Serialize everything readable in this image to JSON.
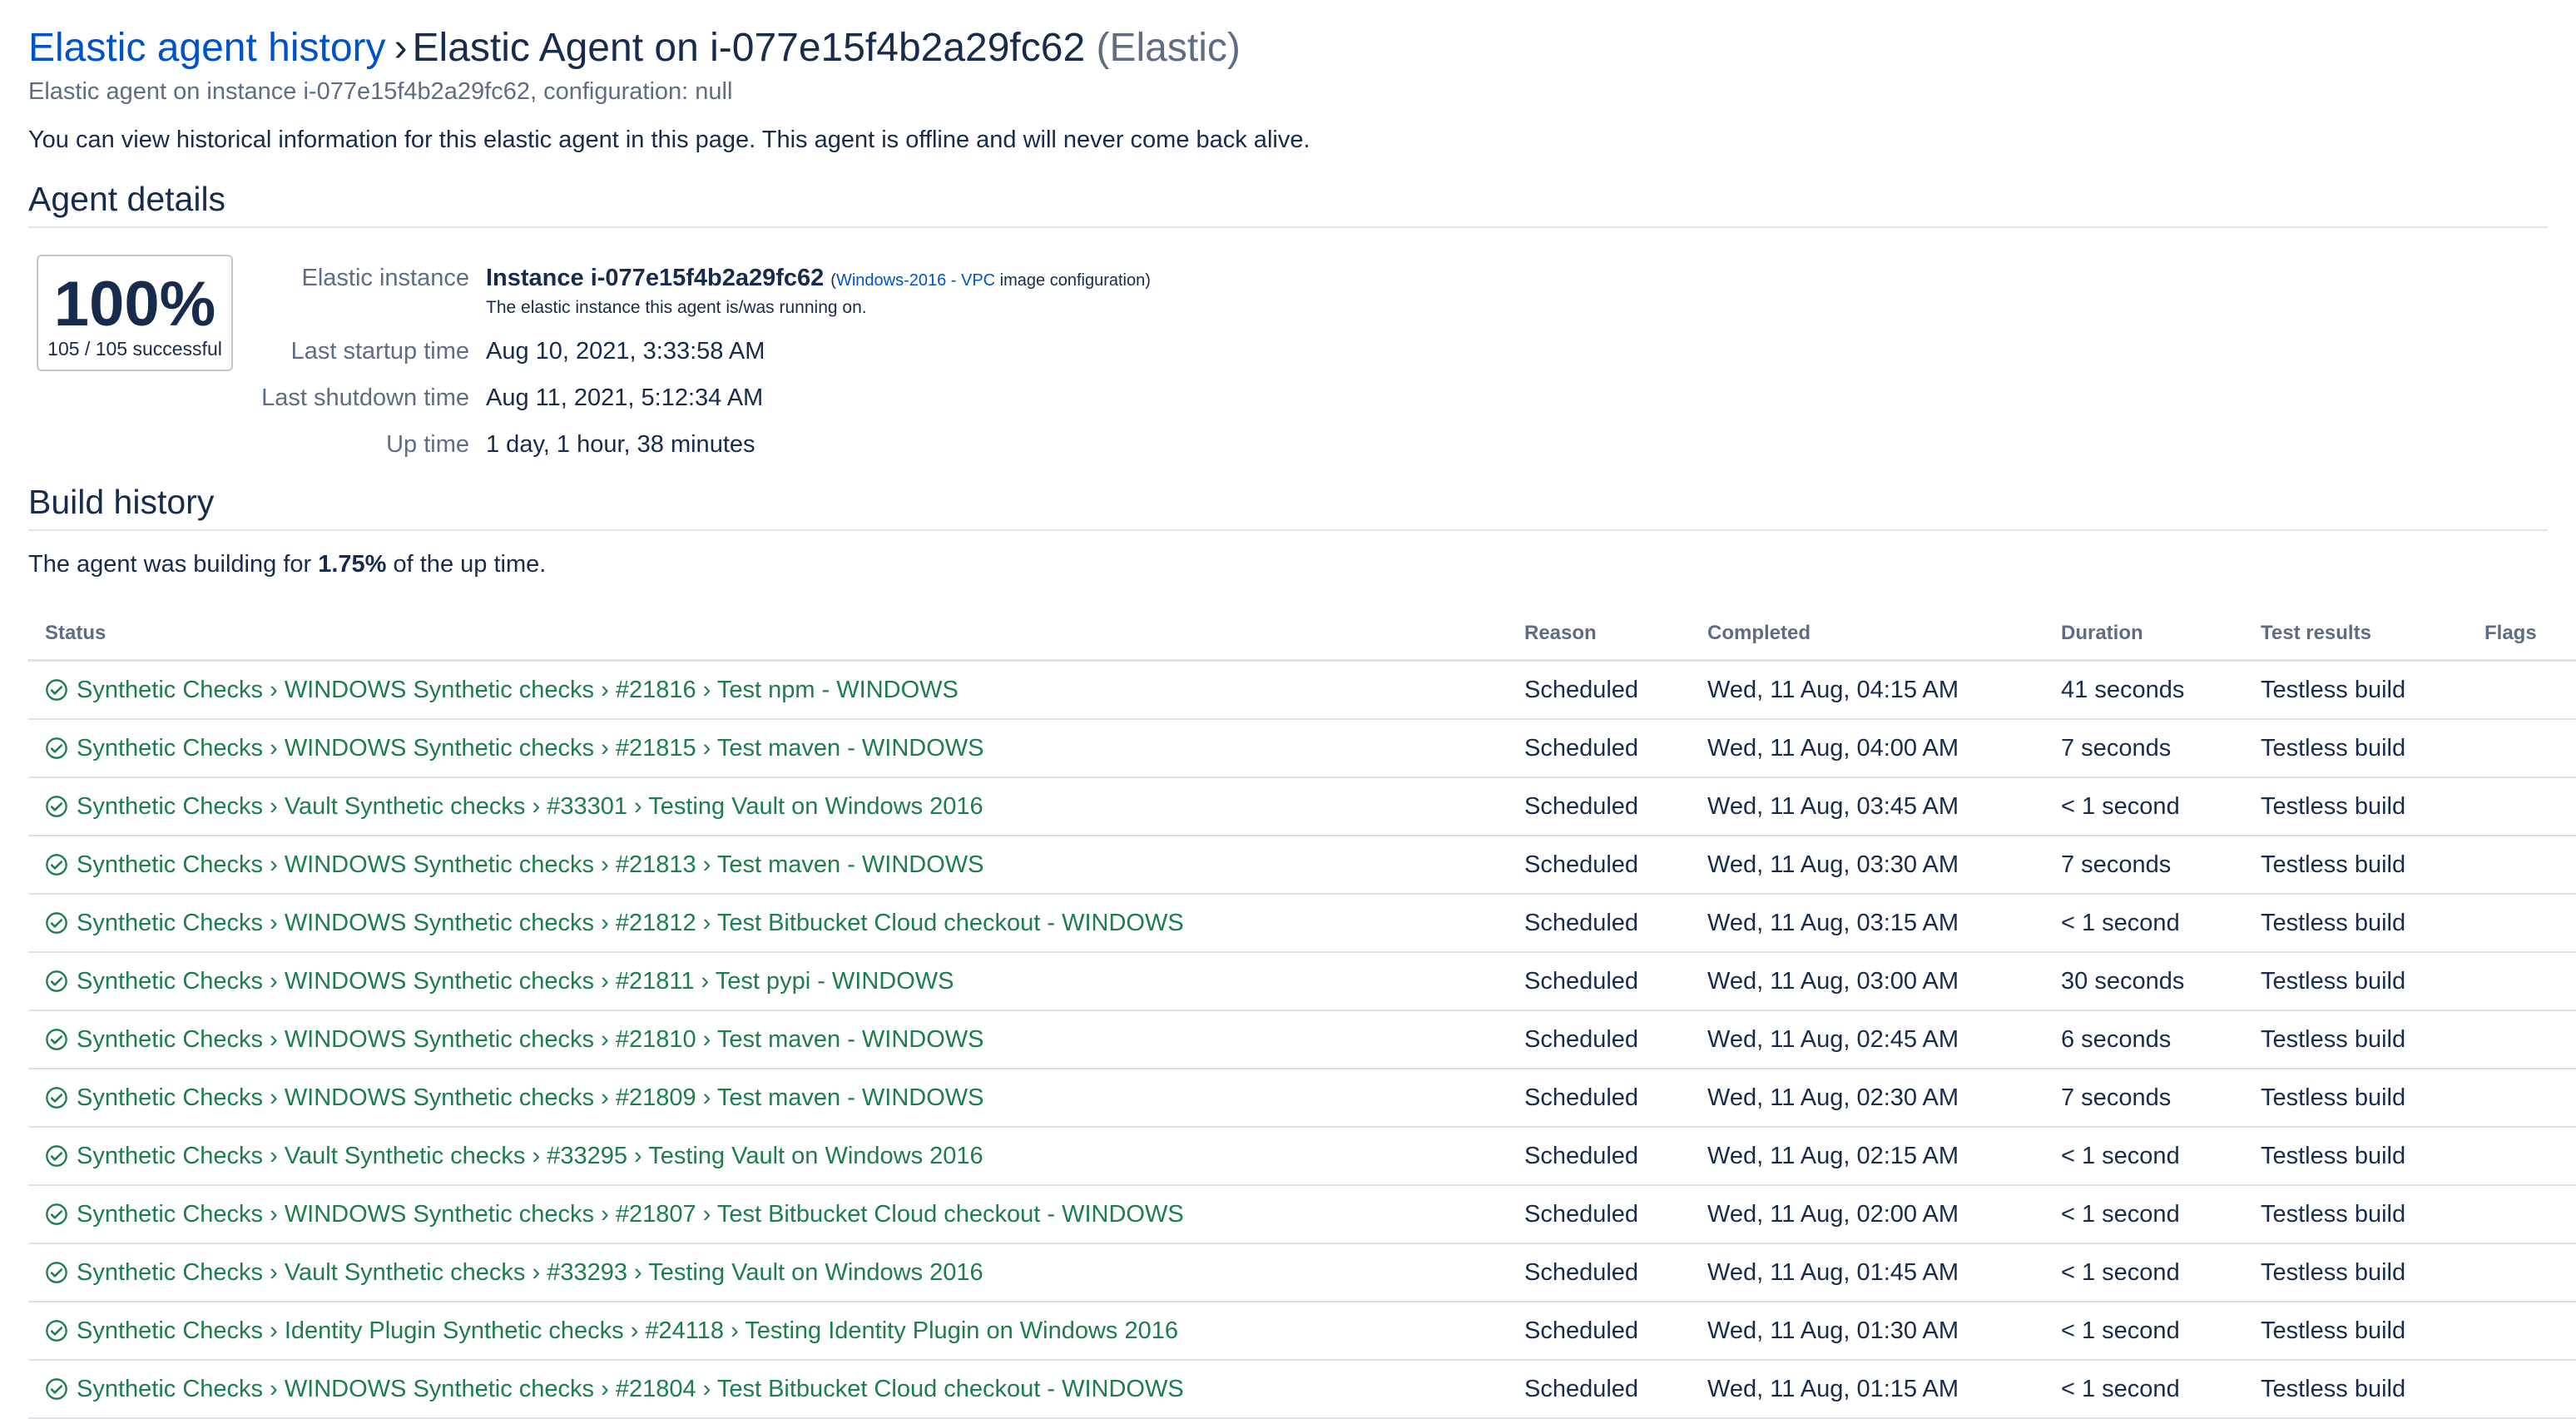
{
  "header": {
    "breadcrumb_link": "Elastic agent history",
    "separator": "›",
    "agent_title": "Elastic Agent on i-077e15f4b2a29fc62",
    "agent_type": "(Elastic)",
    "subtitle": "Elastic agent on instance i-077e15f4b2a29fc62, configuration: null",
    "intro": "You can view historical information for this elastic agent in this page. This agent is offline and will never come back alive."
  },
  "agent_details": {
    "heading": "Agent details",
    "success_percent": "100%",
    "success_count": "105 / 105 successful",
    "elastic_instance_label": "Elastic instance",
    "instance_name": "Instance i-077e15f4b2a29fc62",
    "instance_meta_open": "(",
    "instance_meta_link": "Windows-2016 - VPC",
    "instance_meta_rest": " image configuration)",
    "instance_note": "The elastic instance this agent is/was running on.",
    "last_startup_label": "Last startup time",
    "last_startup_value": "Aug 10, 2021, 3:33:58 AM",
    "last_shutdown_label": "Last shutdown time",
    "last_shutdown_value": "Aug 11, 2021, 5:12:34 AM",
    "up_time_label": "Up time",
    "up_time_value": "1 day, 1 hour, 38 minutes"
  },
  "build_history": {
    "heading": "Build history",
    "building_prefix": "The agent was building for ",
    "building_percent": "1.75%",
    "building_suffix": " of the up time.",
    "columns": [
      "Status",
      "Reason",
      "Completed",
      "Duration",
      "Test results",
      "Flags"
    ],
    "status_color": "#1c7d4d",
    "rows": [
      {
        "status": "Synthetic Checks › WINDOWS Synthetic checks › #21816 › Test npm - WINDOWS",
        "reason": "Scheduled",
        "completed": "Wed, 11 Aug, 04:15 AM",
        "duration": "41 seconds",
        "tests": "Testless build",
        "flags": ""
      },
      {
        "status": "Synthetic Checks › WINDOWS Synthetic checks › #21815 › Test maven - WINDOWS",
        "reason": "Scheduled",
        "completed": "Wed, 11 Aug, 04:00 AM",
        "duration": "7 seconds",
        "tests": "Testless build",
        "flags": ""
      },
      {
        "status": "Synthetic Checks › Vault Synthetic checks › #33301 › Testing Vault on Windows 2016",
        "reason": "Scheduled",
        "completed": "Wed, 11 Aug, 03:45 AM",
        "duration": "< 1 second",
        "tests": "Testless build",
        "flags": ""
      },
      {
        "status": "Synthetic Checks › WINDOWS Synthetic checks › #21813 › Test maven - WINDOWS",
        "reason": "Scheduled",
        "completed": "Wed, 11 Aug, 03:30 AM",
        "duration": "7 seconds",
        "tests": "Testless build",
        "flags": ""
      },
      {
        "status": "Synthetic Checks › WINDOWS Synthetic checks › #21812 › Test Bitbucket Cloud checkout - WINDOWS",
        "reason": "Scheduled",
        "completed": "Wed, 11 Aug, 03:15 AM",
        "duration": "< 1 second",
        "tests": "Testless build",
        "flags": ""
      },
      {
        "status": "Synthetic Checks › WINDOWS Synthetic checks › #21811 › Test pypi - WINDOWS",
        "reason": "Scheduled",
        "completed": "Wed, 11 Aug, 03:00 AM",
        "duration": "30 seconds",
        "tests": "Testless build",
        "flags": ""
      },
      {
        "status": "Synthetic Checks › WINDOWS Synthetic checks › #21810 › Test maven - WINDOWS",
        "reason": "Scheduled",
        "completed": "Wed, 11 Aug, 02:45 AM",
        "duration": "6 seconds",
        "tests": "Testless build",
        "flags": ""
      },
      {
        "status": "Synthetic Checks › WINDOWS Synthetic checks › #21809 › Test maven - WINDOWS",
        "reason": "Scheduled",
        "completed": "Wed, 11 Aug, 02:30 AM",
        "duration": "7 seconds",
        "tests": "Testless build",
        "flags": ""
      },
      {
        "status": "Synthetic Checks › Vault Synthetic checks › #33295 › Testing Vault on Windows 2016",
        "reason": "Scheduled",
        "completed": "Wed, 11 Aug, 02:15 AM",
        "duration": "< 1 second",
        "tests": "Testless build",
        "flags": ""
      },
      {
        "status": "Synthetic Checks › WINDOWS Synthetic checks › #21807 › Test Bitbucket Cloud checkout - WINDOWS",
        "reason": "Scheduled",
        "completed": "Wed, 11 Aug, 02:00 AM",
        "duration": "< 1 second",
        "tests": "Testless build",
        "flags": ""
      },
      {
        "status": "Synthetic Checks › Vault Synthetic checks › #33293 › Testing Vault on Windows 2016",
        "reason": "Scheduled",
        "completed": "Wed, 11 Aug, 01:45 AM",
        "duration": "< 1 second",
        "tests": "Testless build",
        "flags": ""
      },
      {
        "status": "Synthetic Checks › Identity Plugin Synthetic checks › #24118 › Testing Identity Plugin on Windows 2016",
        "reason": "Scheduled",
        "completed": "Wed, 11 Aug, 01:30 AM",
        "duration": "< 1 second",
        "tests": "Testless build",
        "flags": ""
      },
      {
        "status": "Synthetic Checks › WINDOWS Synthetic checks › #21804 › Test Bitbucket Cloud checkout - WINDOWS",
        "reason": "Scheduled",
        "completed": "Wed, 11 Aug, 01:15 AM",
        "duration": "< 1 second",
        "tests": "Testless build",
        "flags": ""
      }
    ]
  }
}
